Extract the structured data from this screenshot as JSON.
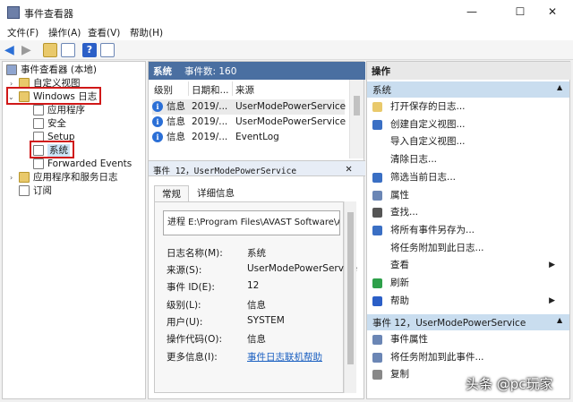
{
  "window": {
    "title": "事件查看器"
  },
  "window_controls": {
    "minimize": "—",
    "maximize": "☐",
    "close": "✕"
  },
  "menu": [
    "文件(F)",
    "操作(A)",
    "查看(V)",
    "帮助(H)"
  ],
  "tree": {
    "root": "事件查看器 (本地)",
    "custom_views": "自定义视图",
    "windows_logs": "Windows 日志",
    "children": [
      "应用程序",
      "安全",
      "Setup",
      "系统",
      "Forwarded Events"
    ],
    "apps_services": "应用程序和服务日志",
    "subscriptions": "订阅"
  },
  "middle": {
    "header_title": "系统",
    "header_count": "事件数: 160",
    "columns": [
      "级别",
      "日期和...",
      "来源"
    ],
    "events": [
      {
        "level": "信息",
        "date": "2019/...",
        "source": "UserModePowerService"
      },
      {
        "level": "信息",
        "date": "2019/...",
        "source": "UserModePowerService"
      },
      {
        "level": "信息",
        "date": "2019/...",
        "source": "EventLog"
      }
    ],
    "detail_title": "事件 12，UserModePowerService",
    "tabs": [
      "常规",
      "详细信息"
    ],
    "description": "进程 E:\\Program Files\\AVAST Software\\A",
    "fields": [
      {
        "label": "日志名称(M):",
        "value": "系统"
      },
      {
        "label": "来源(S):",
        "value": "UserModePowerService"
      },
      {
        "label": "事件 ID(E):",
        "value": "12"
      },
      {
        "label": "级别(L):",
        "value": "信息"
      },
      {
        "label": "用户(U):",
        "value": "SYSTEM"
      },
      {
        "label": "操作代码(O):",
        "value": "信息"
      },
      {
        "label": "更多信息(I):",
        "value": "事件日志联机帮助"
      }
    ]
  },
  "actions": {
    "title": "操作",
    "section1": "系统",
    "items1": [
      {
        "label": "打开保存的日志...",
        "icon": "open-log-icon"
      },
      {
        "label": "创建自定义视图...",
        "icon": "filter-icon"
      },
      {
        "label": "导入自定义视图...",
        "icon": ""
      },
      {
        "label": "清除日志...",
        "icon": ""
      },
      {
        "label": "筛选当前日志...",
        "icon": "filter-icon"
      },
      {
        "label": "属性",
        "icon": "properties-icon"
      },
      {
        "label": "查找...",
        "icon": "find-icon"
      },
      {
        "label": "将所有事件另存为...",
        "icon": "save-icon"
      },
      {
        "label": "将任务附加到此日志...",
        "icon": ""
      },
      {
        "label": "查看",
        "icon": "",
        "submenu": true
      },
      {
        "label": "刷新",
        "icon": "refresh-icon"
      },
      {
        "label": "帮助",
        "icon": "help-icon",
        "submenu": true
      }
    ],
    "section2": "事件 12，UserModePowerService",
    "items2": [
      {
        "label": "事件属性",
        "icon": "properties-icon"
      },
      {
        "label": "将任务附加到此事件...",
        "icon": "task-icon"
      },
      {
        "label": "复制",
        "icon": "copy-icon"
      }
    ]
  },
  "watermark": "头条 @pc玩家",
  "colors": {
    "accent": "#4a6fa1",
    "section": "#c9ddef",
    "highlight": "#d01818"
  }
}
